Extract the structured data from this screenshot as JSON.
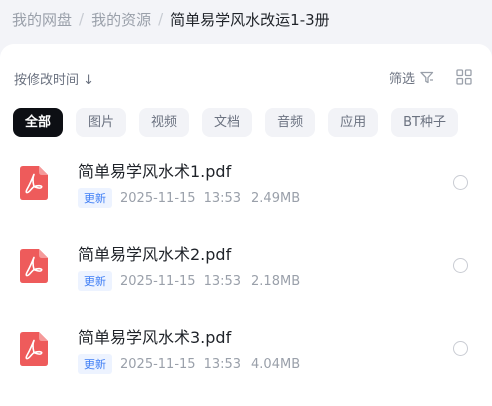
{
  "breadcrumb": {
    "items": [
      "我的网盘",
      "我的资源"
    ],
    "separator": "/",
    "current": "简单易学风水改运1-3册"
  },
  "toolbar": {
    "sort_label": "按修改时间 ↓",
    "filter_label": "筛选",
    "filter_icon": "filter-icon",
    "view_icon": "grid-view-icon"
  },
  "categories": [
    "全部",
    "图片",
    "视频",
    "文档",
    "音频",
    "应用",
    "BT种子"
  ],
  "active_category": "全部",
  "files": [
    {
      "name": "简单易学风水术1.pdf",
      "badge": "更新",
      "date": "2025-11-15",
      "time": "13:53",
      "size": "2.49MB",
      "icon": "pdf-icon"
    },
    {
      "name": "简单易学风水术2.pdf",
      "badge": "更新",
      "date": "2025-11-15",
      "time": "13:53",
      "size": "2.18MB",
      "icon": "pdf-icon"
    },
    {
      "name": "简单易学风水术3.pdf",
      "badge": "更新",
      "date": "2025-11-15",
      "time": "13:53",
      "size": "4.04MB",
      "icon": "pdf-icon"
    }
  ],
  "colors": {
    "pdf_red": "#ee5b5b",
    "badge_blue": "#3f7ef5",
    "active_chip": "#0d0f14"
  }
}
